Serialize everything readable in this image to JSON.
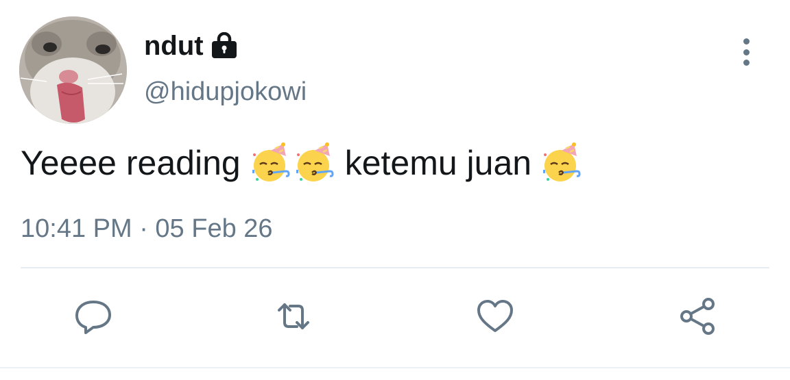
{
  "tweet": {
    "display_name": "ndut",
    "handle": "@hidupjokowi",
    "protected_icon": "lock-icon",
    "text_parts": {
      "part1": "Yeeee reading",
      "part2": "ketemu juan"
    },
    "emoji": "partying-face",
    "timestamp": "10:41 PM · 05 Feb 26"
  },
  "actions": {
    "reply_icon": "reply-icon",
    "retweet_icon": "retweet-icon",
    "like_icon": "heart-icon",
    "share_icon": "share-icon",
    "more_icon": "more-vertical-icon"
  },
  "colors": {
    "text_primary": "#14171a",
    "text_secondary": "#657786",
    "divider": "#e6ecf0"
  }
}
